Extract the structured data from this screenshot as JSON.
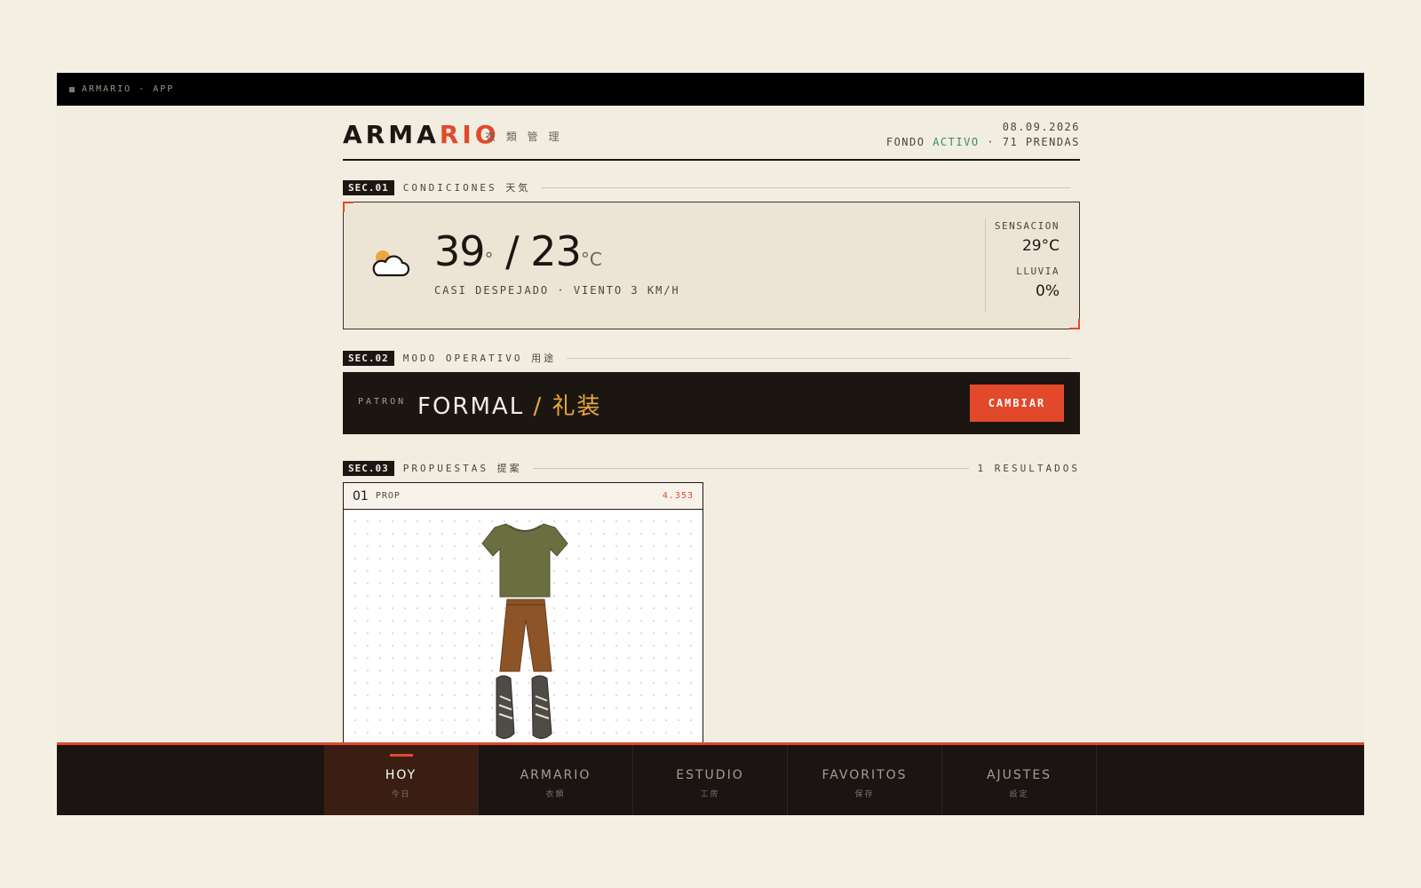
{
  "app_bar": {
    "title": "ARMARIO · APP"
  },
  "header": {
    "logo_main": "ARMA",
    "logo_accent": "RIO",
    "subtitle": "衣 類 管 理",
    "date": "08.09.2026",
    "status_prefix": "FONDO",
    "status_active": "ACTIVO",
    "status_suffix": "· 71 PRENDAS"
  },
  "sections": [
    {
      "badge": "SEC.01",
      "title": "CONDICIONES 天気"
    },
    {
      "badge": "SEC.02",
      "title": "MODO OPERATIVO 用途"
    },
    {
      "badge": "SEC.03",
      "title": "PROPUESTAS 提案",
      "right": "1 RESULTADOS"
    }
  ],
  "weather": {
    "icon": "partly-cloudy-icon",
    "high": "39",
    "high_unit": "°",
    "separator": "/",
    "low": "23",
    "low_unit": "°C",
    "condition": "CASI DESPEJADO · VIENTO 3 KM/H",
    "feels_label": "SENSACION",
    "feels_value": "29°C",
    "rain_label": "LLUVIA",
    "rain_value": "0%"
  },
  "mode": {
    "label": "PATRON",
    "value": "FORMAL",
    "slash": "/",
    "value_jp": "礼装",
    "button": "CAMBIAR"
  },
  "proposal": {
    "number": "01",
    "tag": "PROP",
    "score": "4.353",
    "items": [
      "olive-tshirt",
      "brown-trousers",
      "grey-sneakers"
    ]
  },
  "colors": {
    "accent": "#e2492b",
    "gold": "#e8a93a",
    "green": "#3f8a5a",
    "dark": "#1c1613"
  },
  "nav": [
    {
      "label": "HOY",
      "sub": "今日",
      "active": true
    },
    {
      "label": "ARMARIO",
      "sub": "衣類"
    },
    {
      "label": "ESTUDIO",
      "sub": "工房"
    },
    {
      "label": "FAVORITOS",
      "sub": "保存"
    },
    {
      "label": "AJUSTES",
      "sub": "設定"
    }
  ]
}
